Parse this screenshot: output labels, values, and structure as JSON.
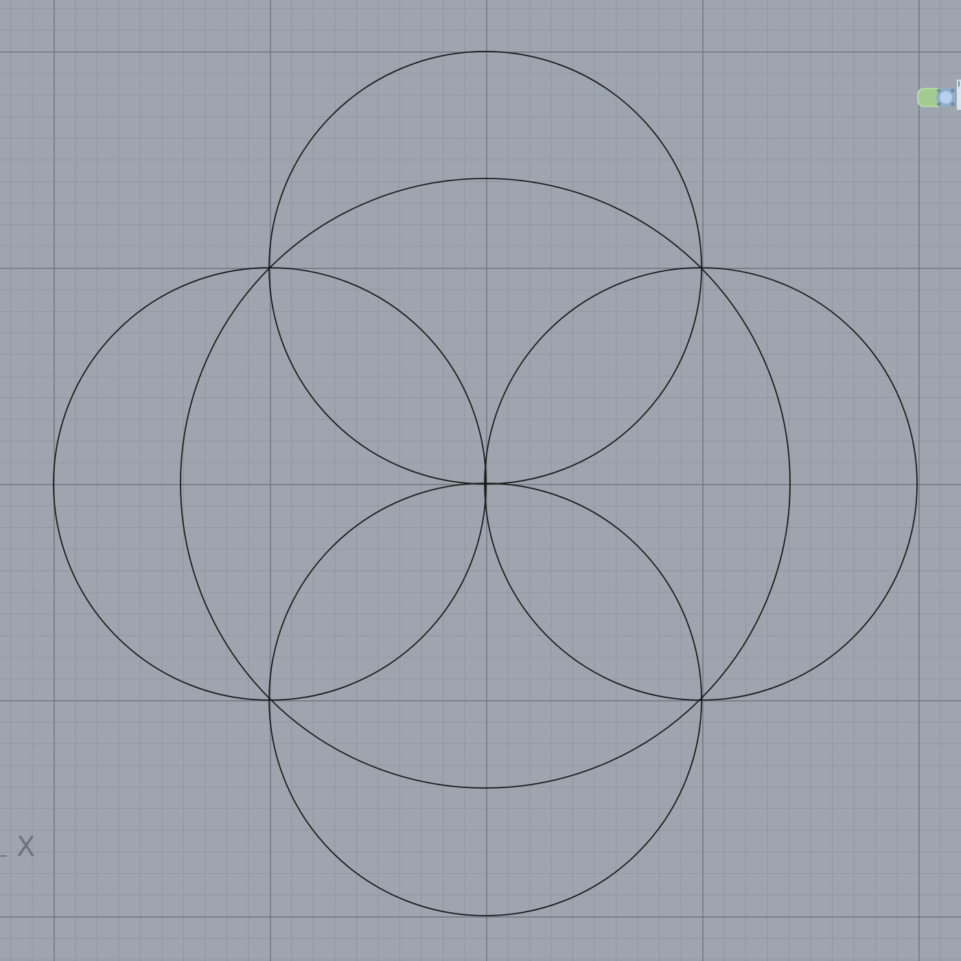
{
  "viewport": {
    "axis_label": "X",
    "colors": {
      "background": "#9ea5ae",
      "grid_major": "#646c76",
      "grid_minor": "#7a828c",
      "curve": "#1a1a1a",
      "widget": "#a9cf9a"
    }
  },
  "geometry": {
    "curves": [
      {
        "name": "curve-circle-top",
        "type": "circle"
      },
      {
        "name": "curve-circle-left",
        "type": "circle"
      },
      {
        "name": "curve-circle-right",
        "type": "circle"
      },
      {
        "name": "curve-circle-bottom",
        "type": "circle"
      },
      {
        "name": "curve-ellipse-center",
        "type": "ellipse"
      }
    ]
  },
  "widgets": {
    "gumball_icon": "gumball-widget-icon"
  }
}
